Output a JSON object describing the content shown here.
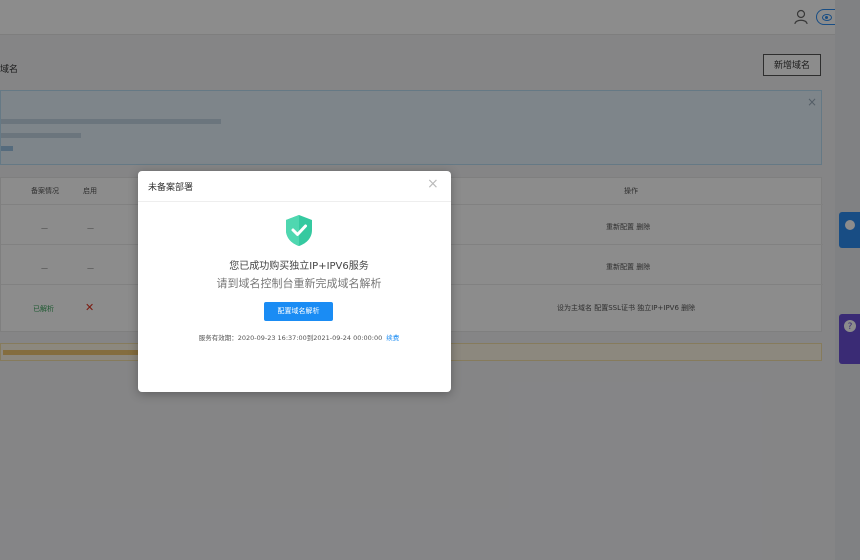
{
  "header": {
    "user_icon": "user-icon",
    "view_button": "预览"
  },
  "page": {
    "title": "域名",
    "add_button": "新增域名"
  },
  "alert": {
    "lines": [
      "",
      "",
      ""
    ]
  },
  "table": {
    "columns": [
      "备案情况",
      "启用",
      "操作"
    ],
    "rows": [
      {
        "status": "—",
        "enabled": "—",
        "actions": "重新配置  删除"
      },
      {
        "status": "—",
        "enabled": "—",
        "actions": "重新配置  删除"
      },
      {
        "status": "已解析",
        "enabled": "✕",
        "actions": "设为主域名  配置SSL证书  独立IP+IPV6  删除"
      }
    ]
  },
  "warning": {
    "text": ""
  },
  "modal": {
    "title": "未备案部署",
    "message_line1": "您已成功购买独立IP+IPV6服务",
    "message_line2": "请到域名控制台重新完成域名解析",
    "button": "配置域名解析",
    "validity_label": "服务有效期：2020-09-23 16:37:00到2021-09-24 00:00:00",
    "renew_link": "续费"
  },
  "colors": {
    "accent": "#1a8cf4",
    "shield": "#35c9a0",
    "danger": "#e0301e"
  }
}
